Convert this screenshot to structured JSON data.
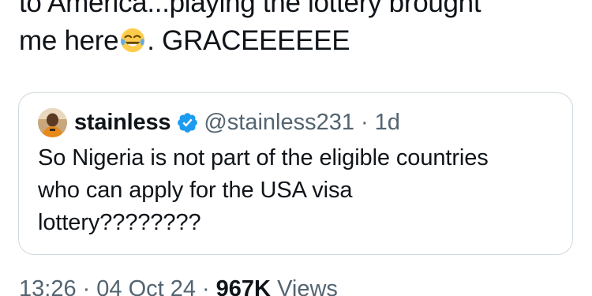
{
  "tweet": {
    "text_line_1": "to America...playing the lottery brought",
    "text_line_2_before": "me here",
    "text_line_2_after": ". GRACEEEEEE",
    "emoji": "face-with-tears-of-joy-icon"
  },
  "quoted_tweet": {
    "display_name": "stainless",
    "handle": "@stainless231",
    "separator": "·",
    "time_ago": "1d",
    "text_lines": [
      "So Nigeria is not part of the eligible countries",
      "who can apply for the USA visa",
      "lottery????????"
    ],
    "verified_color": "#1d9bf0",
    "icons": [
      "avatar",
      "verified-badge-icon"
    ]
  },
  "meta": {
    "time": "13:26",
    "dot": "·",
    "date": "04 Oct 24",
    "views_count": "967K",
    "views_label": "Views"
  },
  "colors": {
    "text": "#0f1419",
    "muted": "#536471",
    "border": "#cfd9de",
    "accent": "#1d9bf0"
  }
}
